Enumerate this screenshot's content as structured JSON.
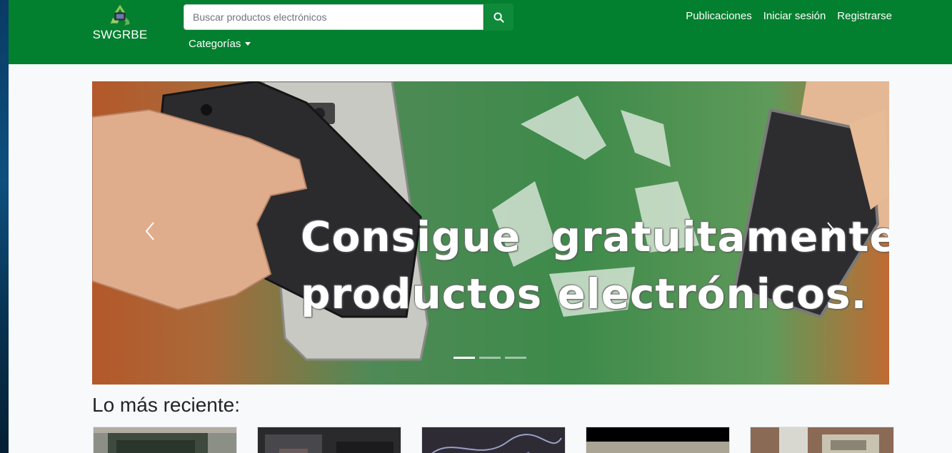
{
  "brand": {
    "name": "SWGRBE",
    "logo_icon": "recycle-electronics-logo"
  },
  "search": {
    "placeholder": "Buscar productos electrónicos",
    "value": "",
    "button_icon": "search-icon"
  },
  "categories": {
    "label": "Categorías"
  },
  "nav": {
    "links": [
      {
        "label": "Publicaciones"
      },
      {
        "label": "Iniciar sesión"
      },
      {
        "label": "Registrarse"
      }
    ]
  },
  "carousel": {
    "caption_line1": "Consigue  gratuitamente",
    "caption_line2": "productos electrónicos.",
    "active_slide": 1,
    "slide_count": 3,
    "prev_icon": "chevron-left-icon",
    "next_icon": "chevron-right-icon"
  },
  "recent": {
    "title": "Lo más reciente:",
    "items": [
      {
        "thumb": "crt-monitor"
      },
      {
        "thumb": "dark-electronics"
      },
      {
        "thumb": "cables"
      },
      {
        "thumb": "device-top"
      },
      {
        "thumb": "printer"
      }
    ]
  },
  "colors": {
    "navbar": "#03802f",
    "search_button": "#0e8a3a",
    "page_bg": "#f8f9fa"
  }
}
